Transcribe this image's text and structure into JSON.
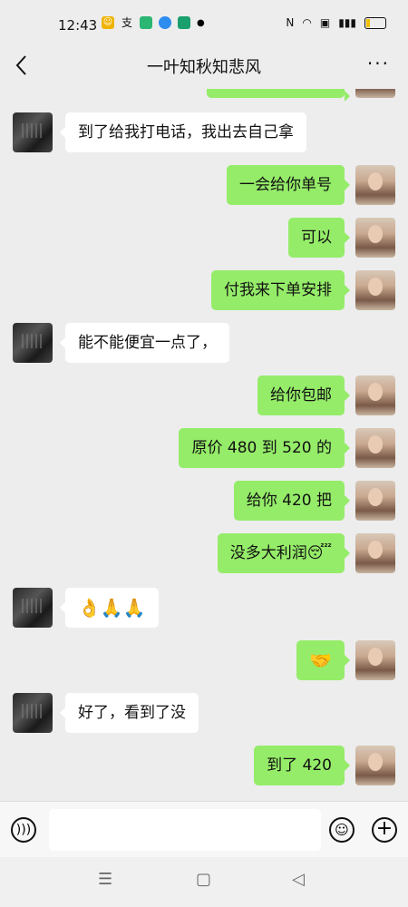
{
  "status": {
    "time": "12:43",
    "icons": [
      "app-icon-1",
      "pay-icon",
      "app-icon-3",
      "app-icon-4",
      "app-icon-5",
      "dot"
    ],
    "right": {
      "nfc": "N",
      "battery_level": 0.2
    }
  },
  "header": {
    "title": "一叶知秋知悲风",
    "more": "···",
    "back": "‹"
  },
  "messages": [
    {
      "side": "left",
      "text": "到了给我打电话，我出去自己拿"
    },
    {
      "side": "right",
      "text": "一会给你单号"
    },
    {
      "side": "right",
      "text": "可以"
    },
    {
      "side": "right",
      "text": "付我来下单安排"
    },
    {
      "side": "left",
      "text": "能不能便宜一点了，"
    },
    {
      "side": "right",
      "text": "给你包邮"
    },
    {
      "side": "right",
      "text": "原价 480 到 520 的"
    },
    {
      "side": "right",
      "text": "给你 420 把"
    },
    {
      "side": "right",
      "text": "没多大利润😴"
    },
    {
      "side": "left",
      "text": "👌🙏🙏"
    },
    {
      "side": "right",
      "text": "🤝"
    },
    {
      "side": "left",
      "text": "好了，看到了没"
    },
    {
      "side": "right",
      "text": "到了 420"
    }
  ],
  "input": {
    "placeholder": ""
  },
  "nav": {
    "menu": "☰",
    "home": "▢",
    "back": "◁"
  }
}
